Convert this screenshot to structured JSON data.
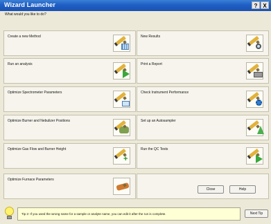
{
  "window": {
    "title": "Wizard Launcher",
    "controls": [
      "?",
      "X"
    ]
  },
  "prompt": "What would you like to do?",
  "tiles": [
    {
      "label": "Create a new Method",
      "icon": "pencil-grid-icon"
    },
    {
      "label": "New Results",
      "icon": "pencil-magnifier-icon"
    },
    {
      "label": "Run an analysis",
      "icon": "pencil-play-icon"
    },
    {
      "label": "Print a Report",
      "icon": "pencil-printer-icon"
    },
    {
      "label": "Optimize Spectrometer Parameters",
      "icon": "pencil-folder-icon"
    },
    {
      "label": "Check Instrument Performance",
      "icon": "pencil-gear-icon"
    },
    {
      "label": "Optimize Burner and Nebulizer Positions",
      "icon": "pencil-burner-icon"
    },
    {
      "label": "Set up an Autosampler",
      "icon": "pencil-arrow-icon"
    },
    {
      "label": "Optimize Gas Flow and Burner Height",
      "icon": "pencil-plus-icon"
    },
    {
      "label": "Run the QC Tests",
      "icon": "pencil-play-icon"
    },
    {
      "label": "Optimize Furnace Parameters",
      "icon": "pencil-brush-icon"
    }
  ],
  "buttons": {
    "close": "Close",
    "help": "Help",
    "next_tip": "Next Tip"
  },
  "tip": "Tip 2: If you used the wrong name for a sample or analyte name, you can edit it after the run is complete."
}
